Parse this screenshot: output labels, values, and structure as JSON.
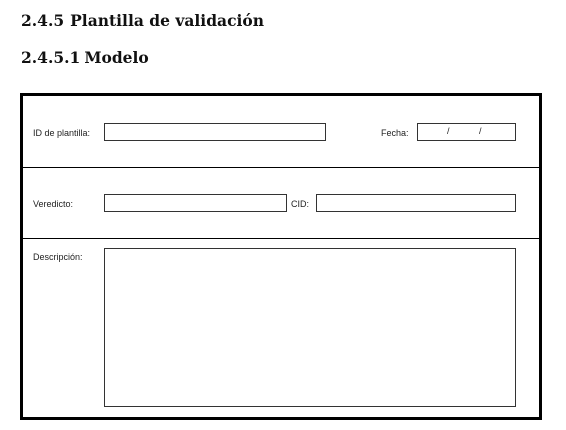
{
  "heading": {
    "number": "2.4.5",
    "title": "Plantilla de validación"
  },
  "subheading": {
    "number": "2.4.5.1",
    "title": "Modelo"
  },
  "form": {
    "template_id": {
      "label": "ID de plantilla:",
      "value": ""
    },
    "date": {
      "label": "Fecha:",
      "separator": "/"
    },
    "verdict": {
      "label": "Veredicto:",
      "value": ""
    },
    "cid": {
      "label": "CID:",
      "value": ""
    },
    "description": {
      "label": "Descripción:",
      "value": ""
    }
  }
}
